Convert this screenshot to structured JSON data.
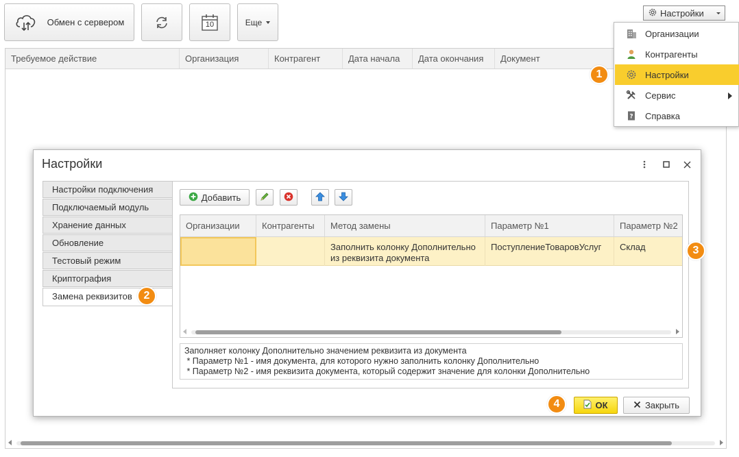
{
  "toolbar": {
    "exchange_label": "Обмен с сервером",
    "refresh_icon": "refresh-icon",
    "calendar_day": "10",
    "more_label": "Еще",
    "settings_label": "Настройки"
  },
  "main_table": {
    "columns": [
      "Требуемое действие",
      "Организация",
      "Контрагент",
      "Дата начала",
      "Дата окончания",
      "Документ"
    ]
  },
  "menu": {
    "items": [
      {
        "label": "Организации",
        "icon": "building-icon"
      },
      {
        "label": "Контрагенты",
        "icon": "person-icon"
      },
      {
        "label": "Настройки",
        "icon": "gear-icon"
      },
      {
        "label": "Сервис",
        "icon": "tools-icon"
      },
      {
        "label": "Справка",
        "icon": "help-icon"
      }
    ]
  },
  "badges": [
    "1",
    "2",
    "3",
    "4"
  ],
  "dialog": {
    "title": "Настройки",
    "tabs": [
      "Настройки подключения",
      "Подключаемый модуль",
      "Хранение данных",
      "Обновление",
      "Тестовый режим",
      "Криптография",
      "Замена реквизитов"
    ],
    "add_label": "Добавить",
    "grid": {
      "columns": [
        "Организации",
        "Контрагенты",
        "Метод замены",
        "Параметр №1",
        "Параметр №2"
      ],
      "row": {
        "org": "",
        "contractor": "",
        "method_line1": "Заполнить колонку Дополнительно",
        "method_line2": "из реквизита документа",
        "param1": "ПоступлениеТоваровУслуг",
        "param2": "Склад"
      }
    },
    "description": [
      "Заполняет колонку Дополнительно значением реквизита из документа",
      " * Параметр №1 - имя документа, для которого нужно заполнить колонку Дополнительно",
      " * Параметр №2 - имя реквизита документа, который содержит значение для колонки Дополнительно"
    ],
    "ok_label": "ОК",
    "close_label": "Закрыть"
  },
  "colors": {
    "accent": "#f9cd2d",
    "badge": "#f28c12",
    "row_selected": "#fdf1c6"
  }
}
